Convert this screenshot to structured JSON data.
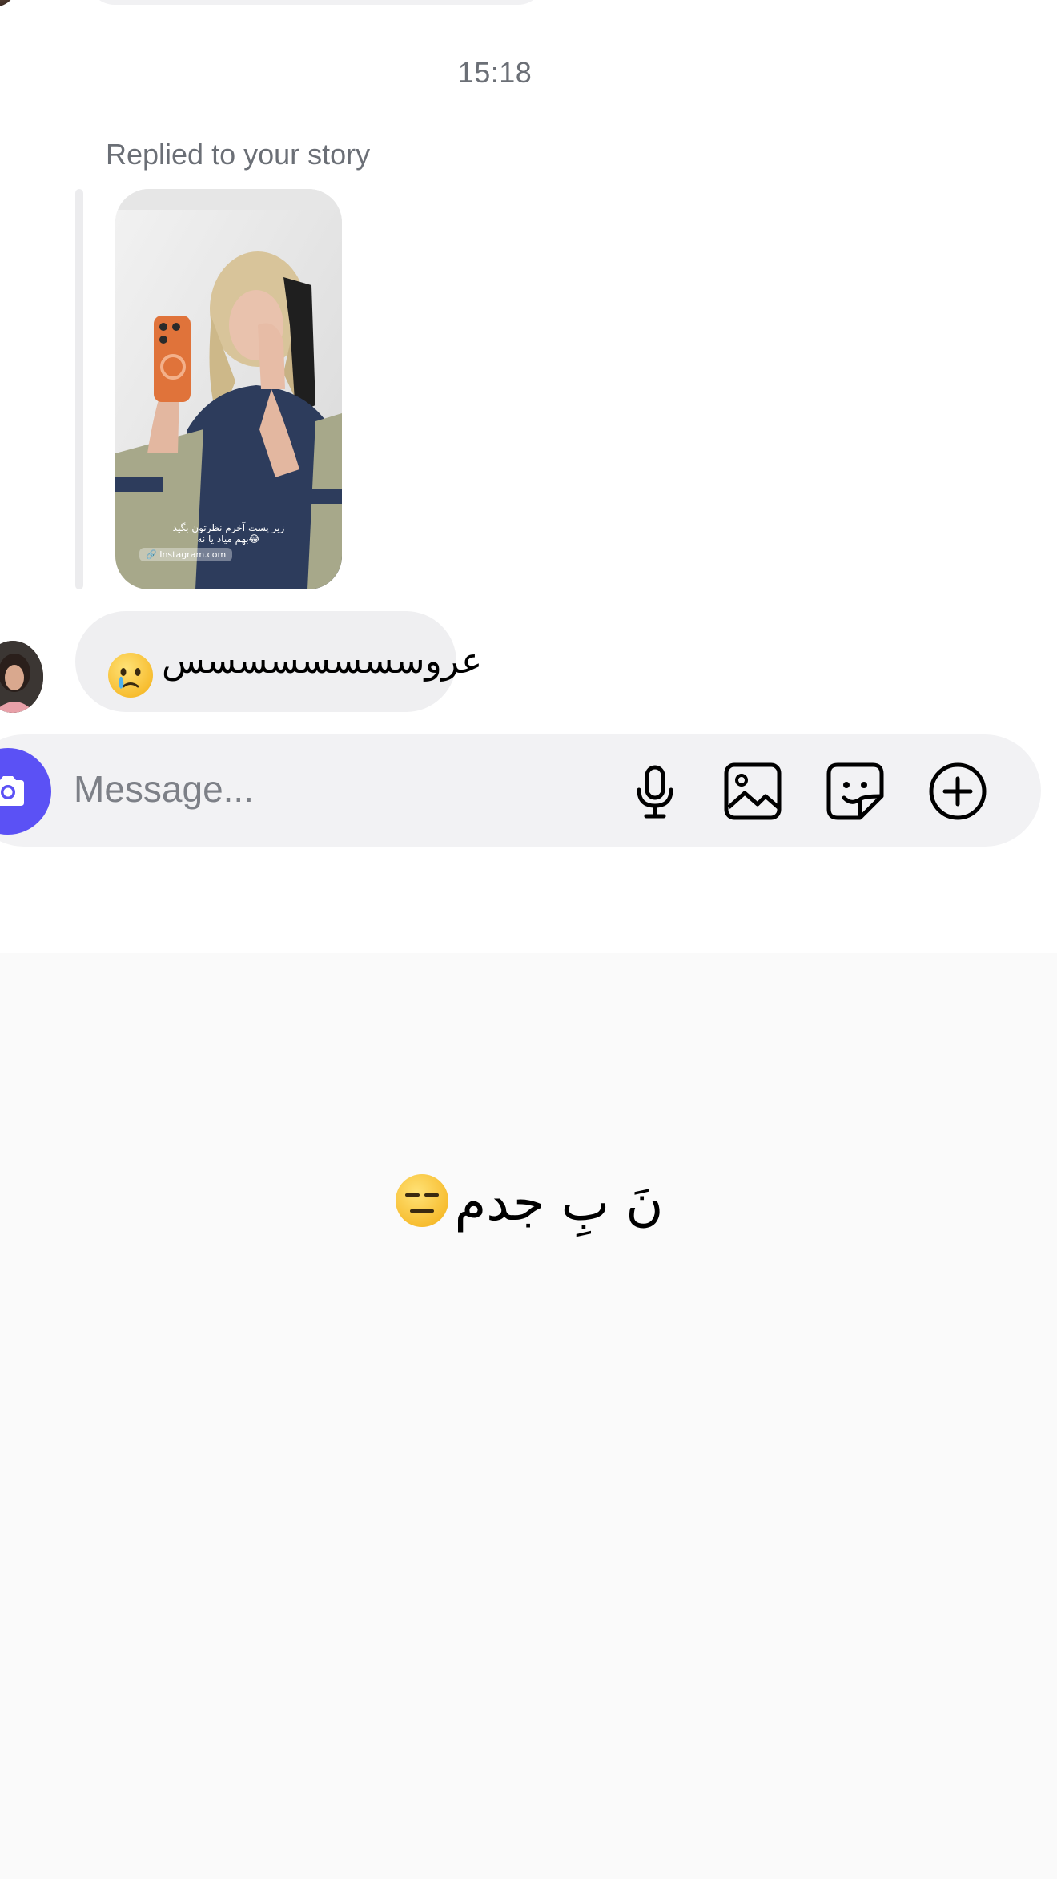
{
  "thread": {
    "timestamp": "15:18",
    "reply_label": "Replied to your story",
    "story": {
      "caption_line1": "زیر پست آخرم نظرتون بگید",
      "caption_line2": "بهم میاد یا نه😂",
      "link": "Instagram.com"
    },
    "message": {
      "text": "عروسسسسسسسس",
      "emoji": "crying-face"
    }
  },
  "composer": {
    "placeholder": "Message...",
    "accent_color": "#5b51f5",
    "icons": [
      "camera-icon",
      "microphone-icon",
      "gallery-icon",
      "sticker-icon",
      "plus-icon"
    ]
  },
  "keyboard_preview": {
    "text": "نَ بِ جدم",
    "emoji": "expressionless-face"
  }
}
